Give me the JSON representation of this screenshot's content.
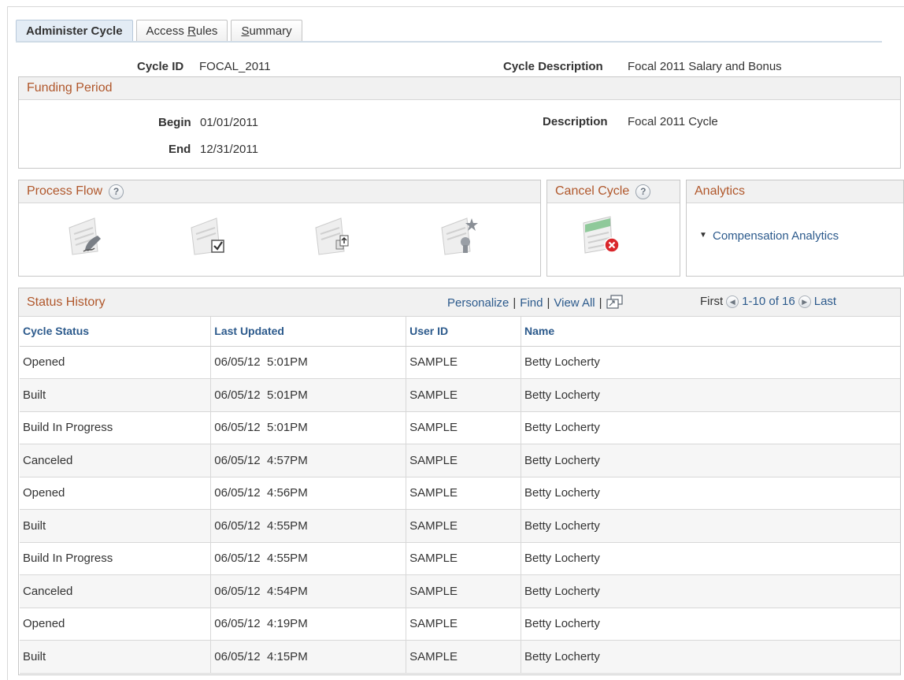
{
  "tabs": [
    {
      "pre": "Administer Cycle",
      "ul": "",
      "post": ""
    },
    {
      "pre": "Access ",
      "ul": "R",
      "post": "ules"
    },
    {
      "pre": "",
      "ul": "S",
      "post": "ummary"
    }
  ],
  "header": {
    "cycle_id_label": "Cycle ID",
    "cycle_id_value": "FOCAL_2011",
    "cycle_desc_label": "Cycle Description",
    "cycle_desc_value": "Focal 2011 Salary and Bonus"
  },
  "funding": {
    "title": "Funding Period",
    "begin_label": "Begin",
    "begin_value": "01/01/2011",
    "end_label": "End",
    "end_value": "12/31/2011",
    "desc_label": "Description",
    "desc_value": "Focal 2011 Cycle"
  },
  "process_flow": {
    "title": "Process Flow",
    "help": "?"
  },
  "cancel_cycle": {
    "title": "Cancel Cycle",
    "help": "?"
  },
  "analytics": {
    "title": "Analytics",
    "link": "Compensation Analytics",
    "arrow": "▼"
  },
  "status_history": {
    "title": "Status History",
    "personalize": "Personalize",
    "find": "Find",
    "view_all": "View All",
    "first": "First",
    "range": "1-10 of 16",
    "last": "Last",
    "columns": [
      "Cycle Status",
      "Last Updated",
      "User ID",
      "Name"
    ],
    "rows": [
      [
        "Opened",
        "06/05/12  5:01PM",
        "SAMPLE",
        "Betty Locherty"
      ],
      [
        "Built",
        "06/05/12  5:01PM",
        "SAMPLE",
        "Betty Locherty"
      ],
      [
        "Build In Progress",
        "06/05/12  5:01PM",
        "SAMPLE",
        "Betty Locherty"
      ],
      [
        "Canceled",
        "06/05/12  4:57PM",
        "SAMPLE",
        "Betty Locherty"
      ],
      [
        "Opened",
        "06/05/12  4:56PM",
        "SAMPLE",
        "Betty Locherty"
      ],
      [
        "Built",
        "06/05/12  4:55PM",
        "SAMPLE",
        "Betty Locherty"
      ],
      [
        "Build In Progress",
        "06/05/12  4:55PM",
        "SAMPLE",
        "Betty Locherty"
      ],
      [
        "Canceled",
        "06/05/12  4:54PM",
        "SAMPLE",
        "Betty Locherty"
      ],
      [
        "Opened",
        "06/05/12  4:19PM",
        "SAMPLE",
        "Betty Locherty"
      ],
      [
        "Built",
        "06/05/12  4:15PM",
        "SAMPLE",
        "Betty Locherty"
      ]
    ]
  },
  "icons": {
    "process_flow": [
      "pen-sign-icon",
      "checkbox-icon",
      "export-icon",
      "award-icon"
    ],
    "cancel": "cancel-cycle-icon",
    "grid_zoom": "view-grid-icon",
    "prev": "previous-page-icon",
    "next": "next-page-icon"
  },
  "colors": {
    "header_text": "#b0572b",
    "link": "#2c5a8c",
    "active_tab": "#e3ecf5",
    "cancel_red": "#d9262b"
  }
}
